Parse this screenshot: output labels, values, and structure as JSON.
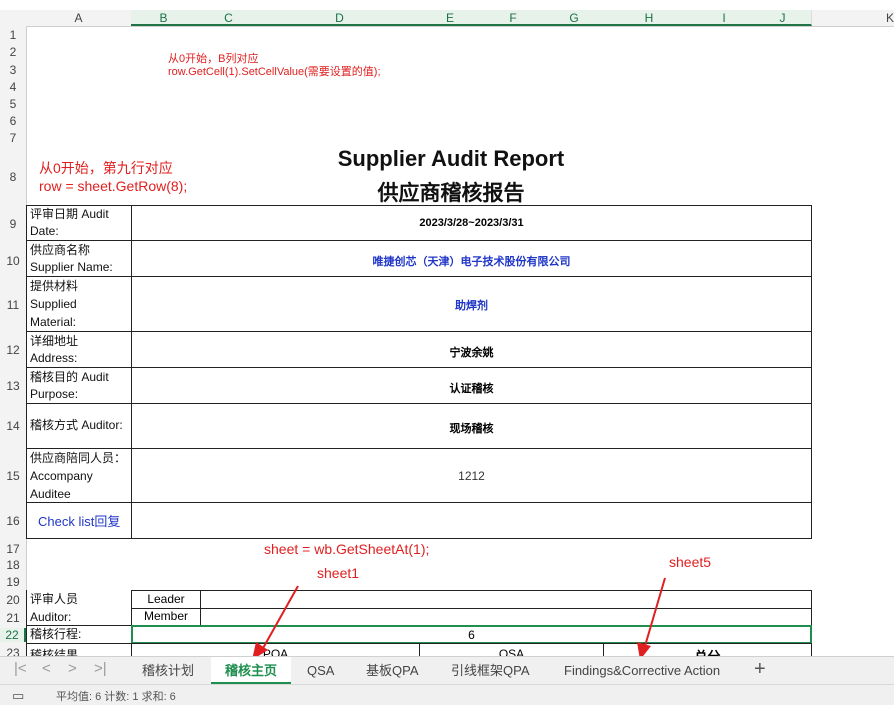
{
  "columns": [
    "A",
    "B",
    "C",
    "D",
    "E",
    "F",
    "G",
    "H",
    "I",
    "J",
    "K"
  ],
  "rows": [
    "1",
    "2",
    "3",
    "4",
    "5",
    "6",
    "7",
    "8",
    "9",
    "10",
    "11",
    "12",
    "13",
    "14",
    "15",
    "16",
    "17",
    "18",
    "19",
    "20",
    "21",
    "22",
    "23"
  ],
  "notes": {
    "col_note_line1": "从0开始，B列对应",
    "col_note_line2": "row.GetCell(1).SetCellValue(需要设置的值);",
    "row_note_line1": "从0开始，第九行对应",
    "row_note_line2": "row = sheet.GetRow(8);",
    "sheet_note": "sheet = wb.GetSheetAt(1);",
    "sheet1_label": "sheet1",
    "sheet5_label": "sheet5"
  },
  "report": {
    "title_en": "Supplier Audit Report",
    "title_cn": "供应商稽核报告",
    "fields": [
      {
        "label_1": "评审日期 Audit",
        "label_2": "Date:",
        "value": "2023/3/28~2023/3/31",
        "blue": false
      },
      {
        "label_1": "供应商名称",
        "label_2": "Supplier Name:",
        "value": "唯捷创芯（天津）电子技术股份有限公司",
        "blue": true
      },
      {
        "label_1": "提供材料",
        "label_2": "Supplied",
        "label_3": "Material:",
        "value": "助焊剂",
        "blue": true
      },
      {
        "label_1": "详细地址",
        "label_2": "Address:",
        "value": "宁波余姚",
        "blue": false
      },
      {
        "label_1": "稽核目的 Audit",
        "label_2": "Purpose:",
        "value": "认证稽核",
        "blue": false
      },
      {
        "label_1": "稽核方式  Auditor:",
        "value": "现场稽核",
        "blue": false
      },
      {
        "label_1": "供应商陪同人员：",
        "label_2": "Accompany",
        "label_3": "Auditee",
        "value": "1212",
        "blue": false
      }
    ],
    "checklist_link": "Check list回复",
    "auditor_label_1": "评审人员",
    "auditor_label_2": "Auditor:",
    "leader_label": "Leader",
    "member_label": "Member",
    "schedule_label": "稽核行程:",
    "schedule_value": "6",
    "row23_label": "稽核结果",
    "row23_c1": "PQA",
    "row23_c2": "QSA",
    "row23_c3": "总分"
  },
  "tabs": [
    "稽核计划",
    "稽核主页",
    "QSA",
    "基板QPA",
    "引线框架QPA",
    "Findings&Corrective Action"
  ],
  "active_tab": "稽核主页",
  "status_text": "平均值: 6  计数: 1  求和: 6",
  "colors": {
    "accent": "#1e8f4e",
    "annotation": "#e02020",
    "link_blue": "#2036c8"
  }
}
